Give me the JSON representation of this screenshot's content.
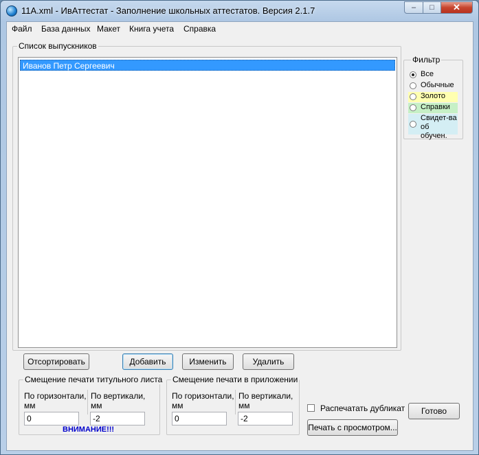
{
  "window": {
    "title": "11A.xml - ИвАттестат - Заполнение школьных аттестатов. Версия 2.1.7",
    "minimize": "–",
    "maximize": "□",
    "close": "✕"
  },
  "menu": [
    "Файл",
    "База данных",
    "Макет",
    "Книга учета",
    "Справка"
  ],
  "graduates": {
    "legend": "Список выпускников",
    "items": [
      "Иванов Петр Сергеевич"
    ]
  },
  "filter": {
    "legend": "Фильтр",
    "options": [
      {
        "label": "Все",
        "checked": true,
        "color": ""
      },
      {
        "label": "Обычные",
        "checked": false,
        "color": ""
      },
      {
        "label": "Золото",
        "checked": false,
        "color": "#ffffb0"
      },
      {
        "label": "Справки",
        "checked": false,
        "color": "#c6f0c6"
      },
      {
        "label": "Свидет-ва об обучен.",
        "checked": false,
        "color": "#d4eef4"
      }
    ]
  },
  "buttons": {
    "sort": "Отсортировать",
    "add": "Добавить",
    "edit": "Изменить",
    "delete": "Удалить",
    "done": "Готово",
    "print_preview": "Печать с просмотром..."
  },
  "title_offset": {
    "legend": "Смещение печати титульного листа",
    "horizontal_label": "По горизонтали, мм",
    "vertical_label": "По вертикали, мм",
    "horizontal_value": "0",
    "vertical_value": "-2",
    "warning": "ВНИМАНИЕ!!!"
  },
  "appendix_offset": {
    "legend": "Смещение печати в приложении",
    "horizontal_label": "По горизонтали, мм",
    "vertical_label": "По вертикали, мм",
    "horizontal_value": "0",
    "vertical_value": "-2"
  },
  "duplicate": {
    "label": "Распечатать дубликат",
    "checked": false
  }
}
